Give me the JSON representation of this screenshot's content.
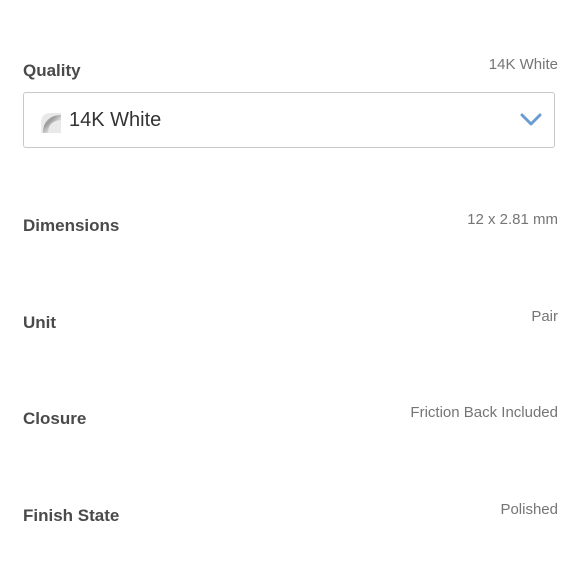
{
  "quality": {
    "label": "Quality",
    "selected_value": "14K White",
    "select": {
      "value": "14K White",
      "swatch_icon": "metal-swatch-icon",
      "chevron_icon": "chevron-down-icon",
      "accent_color": "#6a9ccf"
    }
  },
  "specs": [
    {
      "label": "Dimensions",
      "value": "12 x 2.81 mm"
    },
    {
      "label": "Unit",
      "value": "Pair"
    },
    {
      "label": "Closure",
      "value": "Friction Back Included"
    },
    {
      "label": "Finish State",
      "value": "Polished"
    }
  ]
}
